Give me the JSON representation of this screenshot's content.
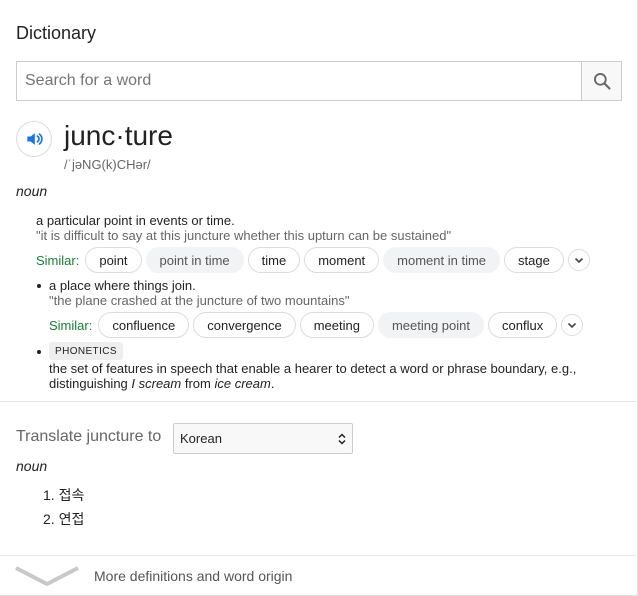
{
  "header": {
    "title": "Dictionary"
  },
  "search": {
    "placeholder": "Search for a word",
    "value": ""
  },
  "entry": {
    "word": "junc·ture",
    "phonetic": "/ˈjəNG(k)CHər/",
    "part_of_speech": "noun",
    "senses": [
      {
        "definition": "a particular point in events or time.",
        "example": "\"it is difficult to say at this juncture whether this upturn can be sustained\"",
        "similar_label": "Similar:",
        "similar": [
          {
            "text": "point",
            "style": "outlined"
          },
          {
            "text": "point in time",
            "style": "filled"
          },
          {
            "text": "time",
            "style": "outlined"
          },
          {
            "text": "moment",
            "style": "outlined"
          },
          {
            "text": "moment in time",
            "style": "filled"
          },
          {
            "text": "stage",
            "style": "outlined"
          }
        ]
      },
      {
        "definition": "a place where things join.",
        "example": "\"the plane crashed at the juncture of two mountains\"",
        "similar_label": "Similar:",
        "similar": [
          {
            "text": "confluence",
            "style": "outlined"
          },
          {
            "text": "convergence",
            "style": "outlined"
          },
          {
            "text": "meeting",
            "style": "outlined"
          },
          {
            "text": "meeting point",
            "style": "filled"
          },
          {
            "text": "conflux",
            "style": "outlined"
          }
        ]
      },
      {
        "label": "PHONETICS",
        "definition_start": "the set of features in speech that enable a hearer to detect a word or phrase boundary, e.g.,",
        "definition_line2_pre": "distinguishing ",
        "definition_ex1": "I scream",
        "definition_mid": " from ",
        "definition_ex2": "ice cream",
        "definition_end": "."
      }
    ]
  },
  "translate": {
    "label": "Translate juncture to",
    "language": "Korean",
    "part_of_speech": "noun",
    "items": [
      "1. 접속",
      "2. 연접"
    ]
  },
  "footer": {
    "more_label": "More definitions and word origin"
  },
  "colors": {
    "accent_blue": "#1a73e8",
    "similar_green": "#188038"
  }
}
